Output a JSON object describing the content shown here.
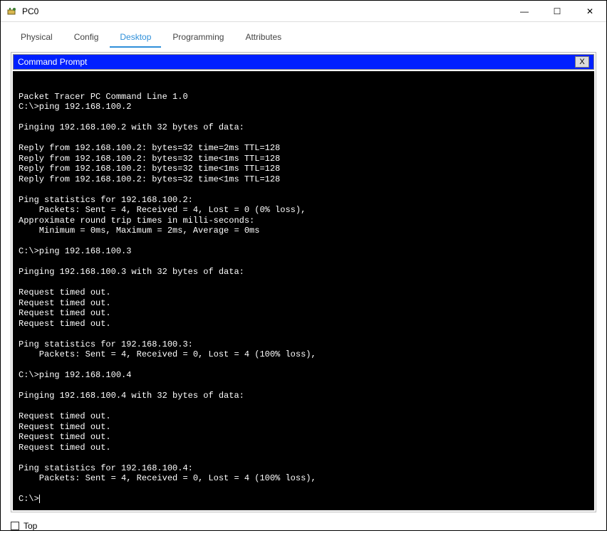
{
  "window": {
    "title": "PC0",
    "minimize": "—",
    "maximize": "☐",
    "close": "✕"
  },
  "tabs": {
    "physical": "Physical",
    "config": "Config",
    "desktop": "Desktop",
    "programming": "Programming",
    "attributes": "Attributes"
  },
  "cmd": {
    "title": "Command Prompt",
    "close": "X"
  },
  "terminal_lines": [
    "",
    "Packet Tracer PC Command Line 1.0",
    "C:\\>ping 192.168.100.2",
    "",
    "Pinging 192.168.100.2 with 32 bytes of data:",
    "",
    "Reply from 192.168.100.2: bytes=32 time=2ms TTL=128",
    "Reply from 192.168.100.2: bytes=32 time<1ms TTL=128",
    "Reply from 192.168.100.2: bytes=32 time<1ms TTL=128",
    "Reply from 192.168.100.2: bytes=32 time<1ms TTL=128",
    "",
    "Ping statistics for 192.168.100.2:",
    "    Packets: Sent = 4, Received = 4, Lost = 0 (0% loss),",
    "Approximate round trip times in milli-seconds:",
    "    Minimum = 0ms, Maximum = 2ms, Average = 0ms",
    "",
    "C:\\>ping 192.168.100.3",
    "",
    "Pinging 192.168.100.3 with 32 bytes of data:",
    "",
    "Request timed out.",
    "Request timed out.",
    "Request timed out.",
    "Request timed out.",
    "",
    "Ping statistics for 192.168.100.3:",
    "    Packets: Sent = 4, Received = 0, Lost = 4 (100% loss),",
    "",
    "C:\\>ping 192.168.100.4",
    "",
    "Pinging 192.168.100.4 with 32 bytes of data:",
    "",
    "Request timed out.",
    "Request timed out.",
    "Request timed out.",
    "Request timed out.",
    "",
    "Ping statistics for 192.168.100.4:",
    "    Packets: Sent = 4, Received = 0, Lost = 4 (100% loss),",
    ""
  ],
  "prompt": "C:\\>",
  "footer": {
    "top_label": "Top"
  }
}
